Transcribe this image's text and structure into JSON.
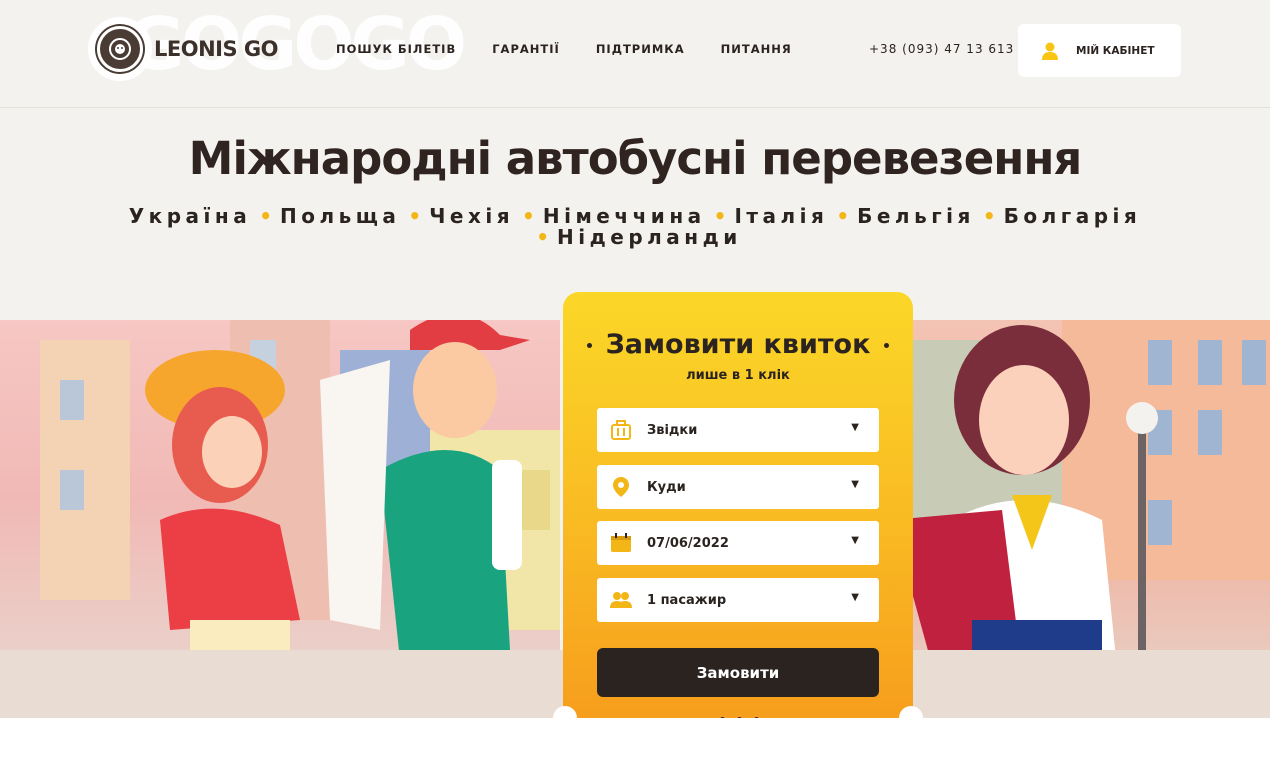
{
  "header": {
    "watermark": "GOGOGO",
    "logo_text": "LEONIS GO",
    "nav": [
      "ПОШУК БІЛЕТІВ",
      "ГАРАНТІЇ",
      "ПІДТРИМКА",
      "ПИТАННЯ"
    ],
    "phone": "+38 (093) 47 13 613",
    "cabinet_label": "МІЙ КАБІНЕТ"
  },
  "hero": {
    "title": "Міжнародні автобусні перевезення",
    "countries": [
      "Україна",
      "Польща",
      "Чехія",
      "Німеччина",
      "Італія",
      "Бельгія",
      "Болгарія",
      "Нідерланди"
    ]
  },
  "booking": {
    "title": "Замовити квиток",
    "subtitle": "лише в 1 клік",
    "fields": [
      {
        "icon": "luggage-icon",
        "value": "Звідки"
      },
      {
        "icon": "location-pin-icon",
        "value": "Куди"
      },
      {
        "icon": "calendar-icon",
        "value": "07/06/2022"
      },
      {
        "icon": "passengers-icon",
        "value": "1 пасажир"
      }
    ],
    "submit_label": "Замовити"
  },
  "colors": {
    "accent": "#f9b822",
    "dark": "#2b2320",
    "background": "#f4f2ef"
  }
}
